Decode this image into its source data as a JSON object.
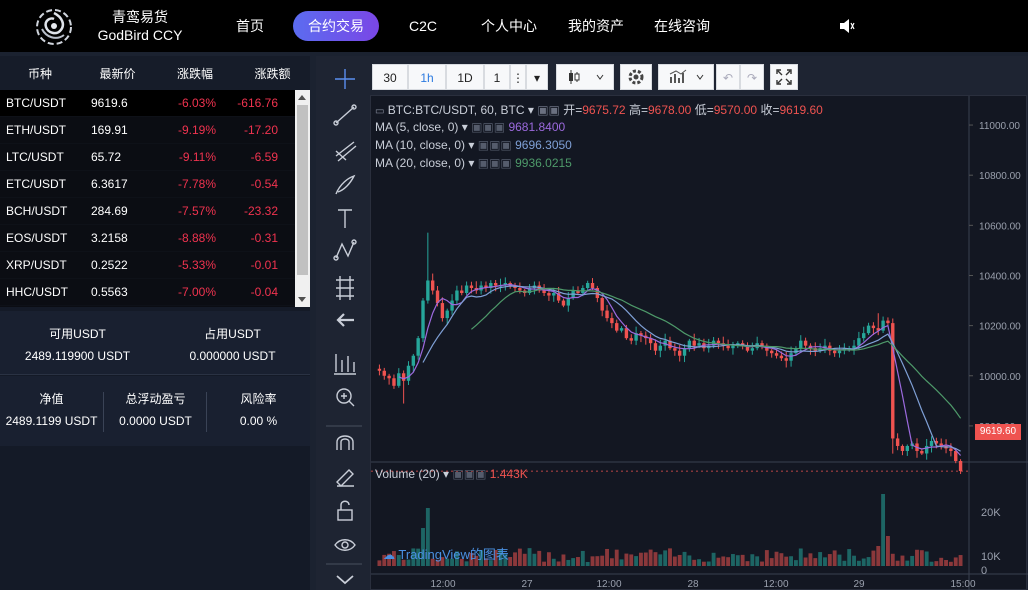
{
  "header": {
    "brand_cn": "青鸾易货",
    "brand_en": "GodBird CCY",
    "nav": [
      "首页",
      "合约交易",
      "C2C",
      "个人中心",
      "我的资产",
      "在线咨询"
    ],
    "active_nav": "合约交易",
    "speaker_icon": "speaker-icon"
  },
  "market": {
    "headers": [
      "币种",
      "最新价",
      "涨跌幅",
      "涨跌额"
    ],
    "rows": [
      {
        "symbol": "BTC/USDT",
        "price": "9619.6",
        "change_pct": "-6.03%",
        "change": "-616.76"
      },
      {
        "symbol": "ETH/USDT",
        "price": "169.91",
        "change_pct": "-9.19%",
        "change": "-17.20"
      },
      {
        "symbol": "LTC/USDT",
        "price": "65.72",
        "change_pct": "-9.11%",
        "change": "-6.59"
      },
      {
        "symbol": "ETC/USDT",
        "price": "6.3617",
        "change_pct": "-7.78%",
        "change": "-0.54"
      },
      {
        "symbol": "BCH/USDT",
        "price": "284.69",
        "change_pct": "-7.57%",
        "change": "-23.32"
      },
      {
        "symbol": "EOS/USDT",
        "price": "3.2158",
        "change_pct": "-8.88%",
        "change": "-0.31"
      },
      {
        "symbol": "XRP/USDT",
        "price": "0.2522",
        "change_pct": "-5.33%",
        "change": "-0.01"
      },
      {
        "symbol": "HHC/USDT",
        "price": "0.5563",
        "change_pct": "-7.00%",
        "change": "-0.04"
      }
    ]
  },
  "funds": {
    "available_label": "可用USDT",
    "available_value": "2489.119900 USDT",
    "occupied_label": "占用USDT",
    "occupied_value": "0.000000 USDT"
  },
  "stats": {
    "net_label": "净值",
    "net_value": "2489.1199 USDT",
    "pnl_label": "总浮动盈亏",
    "pnl_value": "0.0000 USDT",
    "risk_label": "风险率",
    "risk_value": "0.00 %"
  },
  "toolbar": {
    "intervals": [
      "30",
      "1h",
      "1D"
    ],
    "active_interval": "1h",
    "custom_interval": "1",
    "colors": {
      "up": "#26a69a",
      "down": "#ef5350"
    }
  },
  "chart_legend": {
    "symbol": "BTC:BTC/USDT, 60, BTC",
    "open_label": "开=",
    "open": "9675.72",
    "high_label": "高=",
    "high": "9678.00",
    "low_label": "低=",
    "low": "9570.00",
    "close_label": "收=",
    "close": "9619.60",
    "ma5_label": "MA (5, close, 0)",
    "ma5_value": "9681.8400",
    "ma10_label": "MA (10, close, 0)",
    "ma10_value": "9696.3050",
    "ma20_label": "MA (20, close, 0)",
    "ma20_value": "9936.0215",
    "volume_label": "Volume (20)",
    "volume_value": "1.443K",
    "last_price_tag": "9619.60",
    "watermark": "TradingView的图表"
  },
  "chart_data": {
    "type": "candlestick",
    "price_axis": [
      "11000.00",
      "10800.00",
      "10600.00",
      "10400.00",
      "10200.00",
      "10000.00",
      "9800.00"
    ],
    "volume_axis": [
      "20K",
      "10K",
      "0"
    ],
    "time_axis": [
      "12:00",
      "27",
      "12:00",
      "28",
      "12:00",
      "29",
      "15:00"
    ],
    "ylim": [
      9680,
      11060
    ],
    "closes": [
      10020,
      10000,
      9990,
      9960,
      10010,
      9980,
      10040,
      10080,
      10150,
      10300,
      10380,
      10340,
      10290,
      10230,
      10260,
      10300,
      10340,
      10330,
      10360,
      10350,
      10340,
      10360,
      10350,
      10370,
      10360,
      10360,
      10370,
      10360,
      10350,
      10340,
      10330,
      10350,
      10360,
      10340,
      10330,
      10320,
      10330,
      10300,
      10280,
      10310,
      10340,
      10330,
      10350,
      10370,
      10350,
      10310,
      10260,
      10230,
      10210,
      10180,
      10190,
      10150,
      10140,
      10170,
      10160,
      10150,
      10130,
      10100,
      10120,
      10140,
      10110,
      10100,
      10080,
      10110,
      10140,
      10120,
      10130,
      10110,
      10120,
      10140,
      10130,
      10120,
      10110,
      10120,
      10130,
      10120,
      10100,
      10110,
      10130,
      10120,
      10100,
      10090,
      10080,
      10070,
      10060,
      10090,
      10110,
      10140,
      10120,
      10110,
      10100,
      10110,
      10120,
      10100,
      10090,
      10100,
      10110,
      10110,
      10120,
      10150,
      10170,
      10200,
      10190,
      10180,
      10220,
      10210,
      9750,
      9720,
      9700,
      9720,
      9730,
      9700,
      9690,
      9720,
      9740,
      9730,
      9720,
      9710,
      9700,
      9660,
      9620
    ]
  }
}
